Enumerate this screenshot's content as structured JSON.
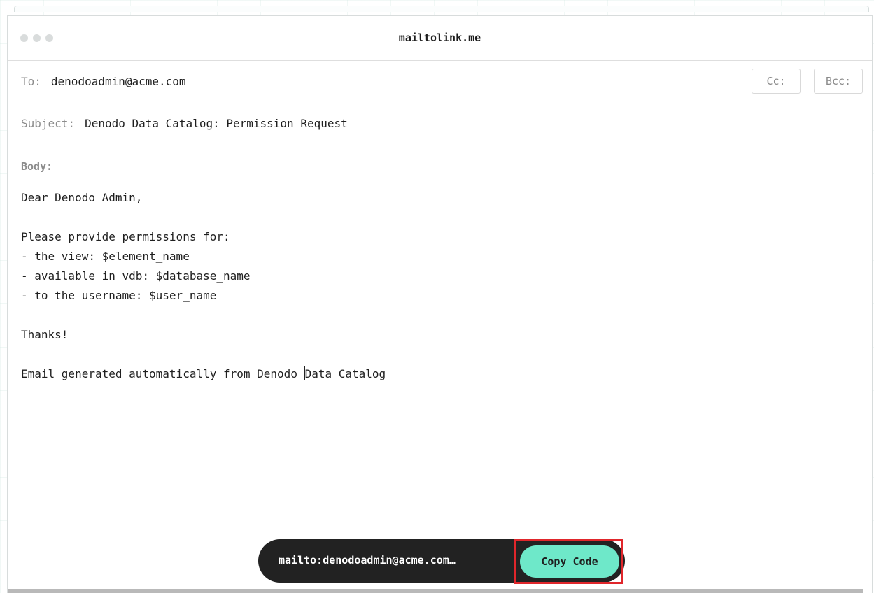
{
  "window": {
    "title": "mailtolink.me"
  },
  "to": {
    "label": "To:",
    "value": "denodoadmin@acme.com"
  },
  "cc_label": "Cc:",
  "bcc_label": "Bcc:",
  "subject": {
    "label": "Subject:",
    "value": "Denodo Data Catalog: Permission Request"
  },
  "body": {
    "label": "Body:",
    "lines": [
      "Dear Denodo Admin,",
      "",
      "Please provide permissions for:",
      "- the view: $element_name",
      "- available in vdb: $database_name",
      "- to the username: $user_name",
      "",
      "Thanks!",
      "",
      "Email generated automatically from Denodo ",
      "Data Catalog"
    ]
  },
  "footer": {
    "mailto_link": "mailto:denodoadmin@acme.com…",
    "copy_button": "Copy Code",
    "highlight_color": "#e0262b",
    "button_color": "#6ee8c9"
  }
}
